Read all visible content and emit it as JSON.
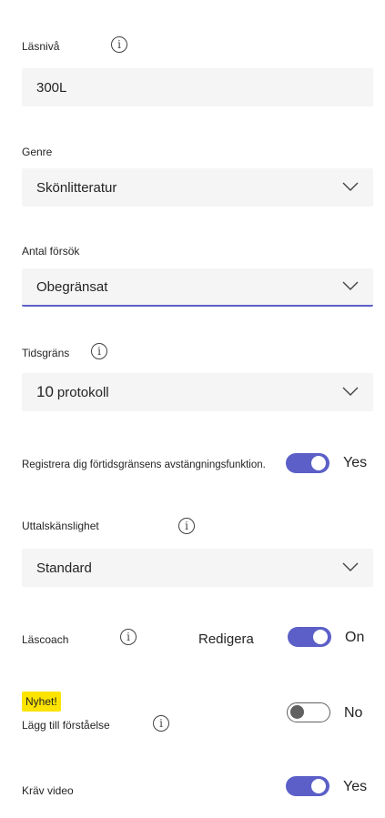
{
  "reading_level": {
    "label": "Läsnivå",
    "value": "300L"
  },
  "genre": {
    "label": "Genre",
    "value": "Skönlitteratur"
  },
  "attempts": {
    "label": "Antal försök",
    "value": "Obegränsat"
  },
  "time_limit": {
    "label": "Tidsgräns",
    "value_number": "10",
    "value_unit": "protokoll"
  },
  "time_limit_cutoff": {
    "label": "Registrera dig förtidsgränsens avstängningsfunktion.",
    "state": "Yes"
  },
  "pronunciation": {
    "label": "Uttalskänslighet",
    "value": "Standard"
  },
  "reading_coach": {
    "label": "Läscoach",
    "edit_label": "Redigera",
    "state": "On"
  },
  "comprehension": {
    "badge": "Nyhet!",
    "label": "Lägg till förståelse",
    "state": "No"
  },
  "require_video": {
    "label": "Kräv video",
    "state": "Yes"
  },
  "colors": {
    "accent": "#5b5fc7",
    "field_bg": "#f5f5f5",
    "badge": "#fde300"
  }
}
